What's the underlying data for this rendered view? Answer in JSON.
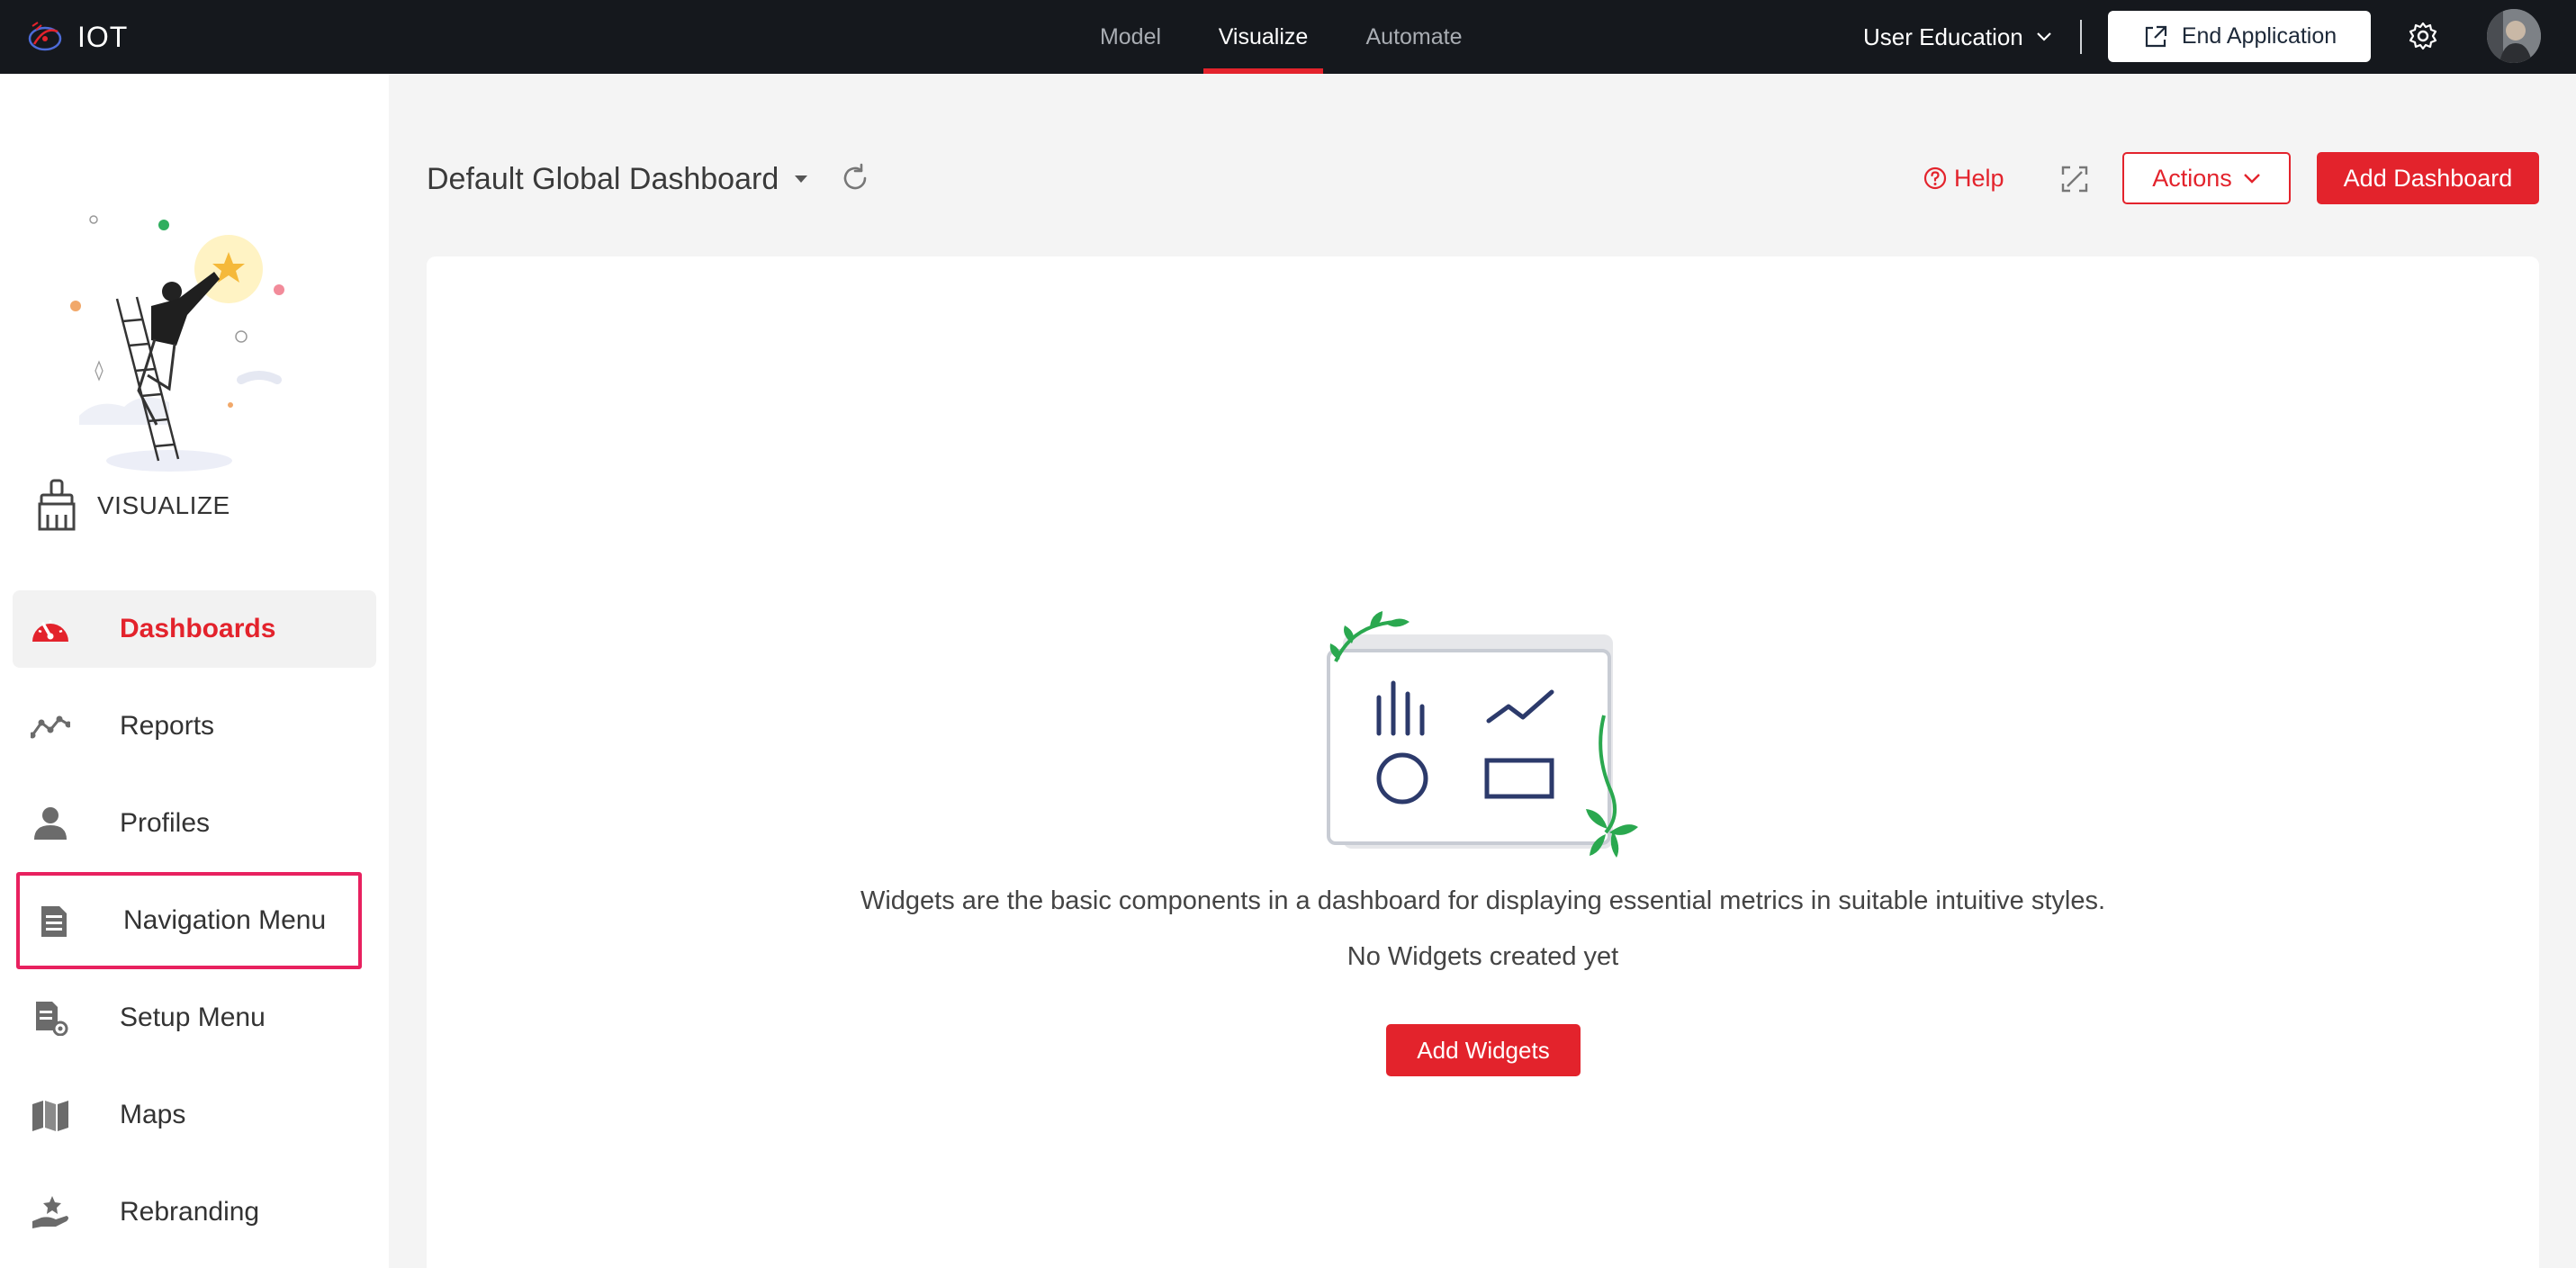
{
  "app": {
    "name": "IOT"
  },
  "topnav": {
    "tabs": [
      {
        "label": "Model"
      },
      {
        "label": "Visualize",
        "active": true
      },
      {
        "label": "Automate"
      }
    ],
    "org_select": "User Education",
    "end_app_label": "End Application"
  },
  "sidebar": {
    "section_title": "VISUALIZE",
    "items": [
      {
        "label": "Dashboards",
        "icon": "speedometer-icon",
        "active": true
      },
      {
        "label": "Reports",
        "icon": "trend-line-icon"
      },
      {
        "label": "Profiles",
        "icon": "user-icon"
      },
      {
        "label": "Navigation Menu",
        "icon": "menu-document-icon",
        "highlighted": true
      },
      {
        "label": "Setup Menu",
        "icon": "setup-document-icon"
      },
      {
        "label": "Maps",
        "icon": "map-icon"
      },
      {
        "label": "Rebranding",
        "icon": "rebranding-hand-icon"
      }
    ]
  },
  "main": {
    "dashboard_title": "Default Global Dashboard",
    "help_label": "Help",
    "actions_label": "Actions",
    "add_dashboard_label": "Add Dashboard",
    "empty_state": {
      "description": "Widgets are the basic components in a dashboard for displaying essential metrics in suitable intuitive styles.",
      "subtext": "No Widgets created yet",
      "add_widgets_label": "Add Widgets"
    }
  },
  "colors": {
    "accent": "#e3232c",
    "topbar_bg": "#15181d",
    "highlight_outline": "#e8215f",
    "page_bg": "#f4f4f4"
  }
}
